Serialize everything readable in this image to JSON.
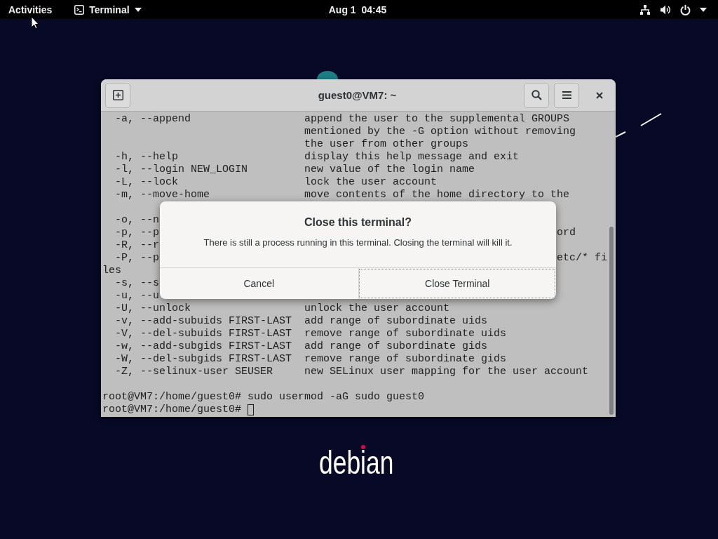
{
  "top_bar": {
    "activities": "Activities",
    "app_menu": {
      "label": "Terminal"
    },
    "clock": "Aug 1  04:45"
  },
  "desktop": {
    "logo": "debian"
  },
  "terminal": {
    "title": "guest0@VM7: ~",
    "lines": [
      {
        "kind": "option",
        "option": "-a, --append",
        "description": "append the user to the supplemental GROUPS"
      },
      {
        "kind": "continuation",
        "description": "mentioned by the -G option without removing"
      },
      {
        "kind": "continuation",
        "description": "the user from other groups"
      },
      {
        "kind": "option",
        "option": "-h, --help",
        "description": "display this help message and exit"
      },
      {
        "kind": "option",
        "option": "-l, --login NEW_LOGIN",
        "description": "new value of the login name"
      },
      {
        "kind": "option",
        "option": "-L, --lock",
        "description": "lock the user account"
      },
      {
        "kind": "option",
        "option": "-m, --move-home",
        "description": "move contents of the home directory to the"
      },
      {
        "kind": "blank"
      },
      {
        "kind": "covered",
        "left": "-o, --n"
      },
      {
        "kind": "covered",
        "left": "-p, --p",
        "right": "ord"
      },
      {
        "kind": "covered",
        "left": "-R, --r"
      },
      {
        "kind": "covered",
        "left": "-P, --p",
        "right": "etc/* fi"
      },
      {
        "kind": "plain",
        "text": "les"
      },
      {
        "kind": "covered",
        "left": "-s, --s"
      },
      {
        "kind": "covered",
        "left": "-u, --u"
      },
      {
        "kind": "option",
        "option": "-U, --unlock",
        "description": "unlock the user account"
      },
      {
        "kind": "option",
        "option": "-v, --add-subuids FIRST-LAST",
        "description": "add range of subordinate uids"
      },
      {
        "kind": "option",
        "option": "-V, --del-subuids FIRST-LAST",
        "description": "remove range of subordinate uids"
      },
      {
        "kind": "option",
        "option": "-w, --add-subgids FIRST-LAST",
        "description": "add range of subordinate gids"
      },
      {
        "kind": "option",
        "option": "-W, --del-subgids FIRST-LAST",
        "description": "remove range of subordinate gids"
      },
      {
        "kind": "option",
        "option": "-Z, --selinux-user SEUSER",
        "description": "new SELinux user mapping for the user account"
      },
      {
        "kind": "blank"
      },
      {
        "kind": "prompt",
        "prompt": "root@VM7:/home/guest0#",
        "command": "sudo usermod -aG sudo guest0",
        "cursor": false
      },
      {
        "kind": "prompt",
        "prompt": "root@VM7:/home/guest0#",
        "cursor": true
      }
    ]
  },
  "dialog": {
    "title": "Close this terminal?",
    "message": "There is still a process running in this terminal. Closing the terminal will kill it.",
    "buttons": [
      {
        "label": "Cancel",
        "focused": false
      },
      {
        "label": "Close Terminal",
        "focused": true
      }
    ]
  }
}
